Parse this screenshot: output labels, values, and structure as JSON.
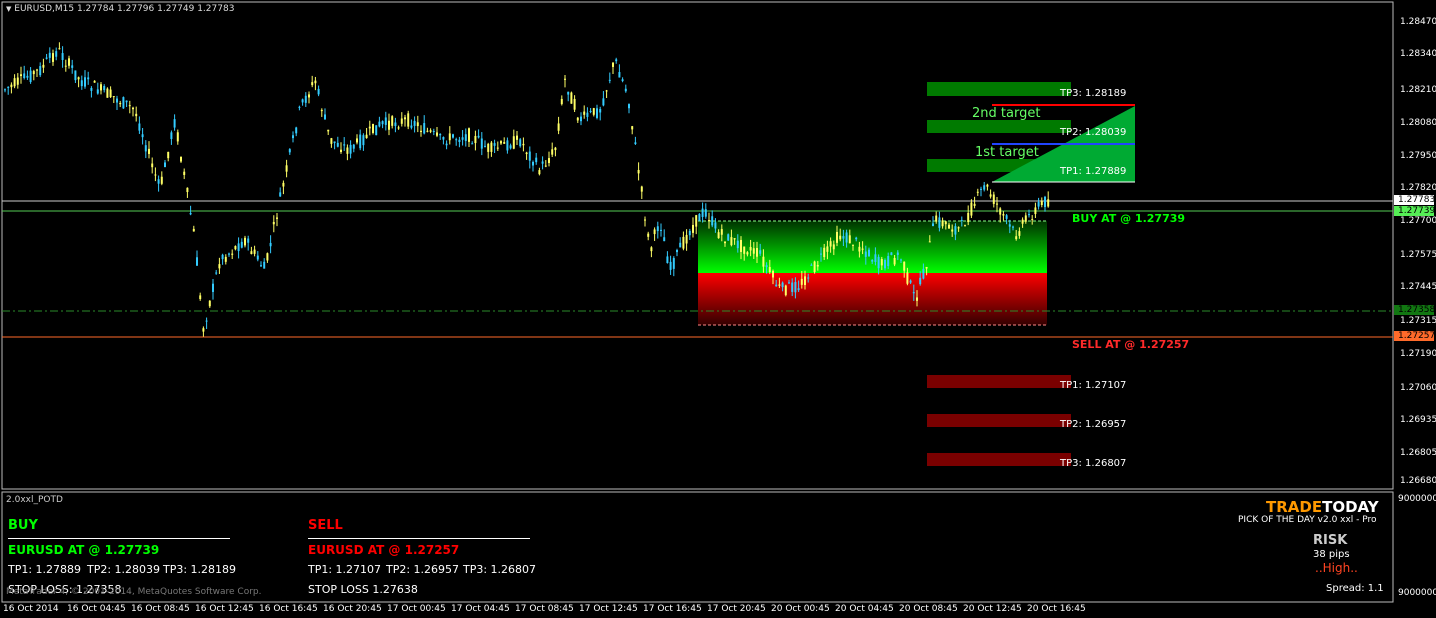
{
  "header": {
    "symbol_text": "EURUSD,M15  1.27784 1.27796 1.27749 1.27783"
  },
  "price_axis": {
    "labels": [
      "1.28470",
      "1.28340",
      "1.28210",
      "1.28080",
      "1.27950",
      "1.27820",
      "1.27700",
      "1.27575",
      "1.27445",
      "1.27315",
      "1.27190",
      "1.27060",
      "1.26935",
      "1.26805",
      "1.26680"
    ],
    "badges": {
      "current_1": "1.27783",
      "current_2": "1.27739",
      "stop_green": "1.27358",
      "sell": "1.27257"
    }
  },
  "time_axis": {
    "labels": [
      "16 Oct 2014",
      "16 Oct 04:45",
      "16 Oct 08:45",
      "16 Oct 12:45",
      "16 Oct 16:45",
      "16 Oct 20:45",
      "17 Oct 00:45",
      "17 Oct 04:45",
      "17 Oct 08:45",
      "17 Oct 12:45",
      "17 Oct 16:45",
      "17 Oct 20:45",
      "20 Oct 00:45",
      "20 Oct 04:45",
      "20 Oct 08:45",
      "20 Oct 12:45",
      "20 Oct 16:45"
    ]
  },
  "targets": {
    "up": {
      "tp3": "TP3: 1.28189",
      "second": "2nd target",
      "tp2": "TP2: 1.28039",
      "first": "1st target",
      "tp1": "TP1: 1.27889"
    },
    "buy_label": "BUY AT @ 1.27739",
    "sell_label": "SELL AT @ 1.27257",
    "down": {
      "tp1": "TP1: 1.27107",
      "tp2": "TP2: 1.26957",
      "tp3": "TP3: 1.26807"
    }
  },
  "indicator": {
    "name": "2.0xxl_POTD",
    "axis_top": "9000000",
    "axis_bottom": "9000000"
  },
  "buy_panel": {
    "title": "BUY",
    "pair": "EURUSD AT @ 1.27739",
    "tp1": "TP1: 1.27889",
    "tp2": "TP2: 1.28039",
    "tp3": "TP3: 1.28189",
    "stop": "STOP LOSS: 1.27358"
  },
  "sell_panel": {
    "title": "SELL",
    "pair": "EURUSD AT @ 1.27257",
    "tp1": "TP1: 1.27107",
    "tp2": "TP2: 1.26957",
    "tp3": "TP3: 1.26807",
    "stop": "STOP LOSS 1.27638"
  },
  "brand": {
    "trade": "TRADE",
    "today": "TODAY",
    "subtitle": "PICK OF THE DAY  v2.0 xxl - Pro",
    "risk_title": "RISK",
    "pips": "38 pips",
    "level": "..High..",
    "spread": "Spread: 1.1"
  },
  "copyright": "MetaTrader 4, © 2001-2014, MetaQuotes Software Corp.",
  "colors": {
    "bull": "#ffff66",
    "bear": "#33ccff",
    "green": "#00ff00",
    "red": "#ff0000",
    "orange": "#ff7a1f",
    "dark_green": "#007a00",
    "dark_red": "#7a0000"
  }
}
